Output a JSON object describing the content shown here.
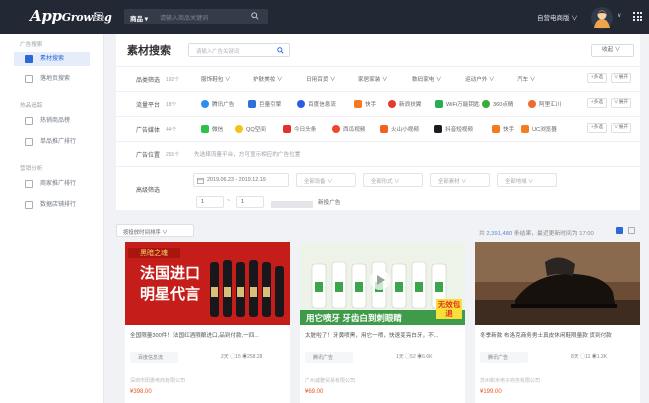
{
  "header": {
    "logo_main": "App",
    "logo_sub": "Growing",
    "search_select": "商品 ▾",
    "search_placeholder": "请输入商品关键词",
    "mode_label": "自营电商版 ∨",
    "user_arrow": "∨"
  },
  "sidebar": {
    "groups": [
      {
        "title": "广告搜索",
        "items": [
          {
            "label": "素材搜索",
            "active": true
          },
          {
            "label": "落地页搜索",
            "active": false
          }
        ]
      },
      {
        "title": "热品追踪",
        "items": [
          {
            "label": "热销商品榜",
            "active": false
          },
          {
            "label": "单品推广排行",
            "active": false
          }
        ]
      },
      {
        "title": "营销分析",
        "items": [
          {
            "label": "商家推广排行",
            "active": false
          },
          {
            "label": "数据店铺排行",
            "active": false
          }
        ]
      }
    ]
  },
  "panel": {
    "title": "素材搜索",
    "search_placeholder": "请输入广告关键词",
    "collapse_label": "收起 ∨",
    "filters": [
      {
        "label": "品类筛选",
        "count": "192个",
        "options": [
          "服饰鞋包 ∨",
          "护肤美妆 ∨",
          "日用百货 ∨",
          "家居家装 ∨",
          "数码家电 ∨",
          "运动户外 ∨",
          "汽车 ∨"
        ],
        "more": "+多选",
        "expand": "∨展开"
      },
      {
        "label": "流量平台",
        "count": "18个",
        "options": [
          "腾讯广告",
          "巨量引擎",
          "百度信息流",
          "快手",
          "新浪扶翼",
          "WiFi万能钥匙",
          "360点睛",
          "阿里汇川"
        ],
        "more": "+多选",
        "expand": "∨展开"
      },
      {
        "label": "广告媒体",
        "count": "44个",
        "options": [
          "微信",
          "QQ空间",
          "今日头条",
          "西瓜视频",
          "火山小视频",
          "抖音短视频",
          "快手",
          "UC浏览器"
        ],
        "more": "+多选",
        "expand": "∨展开"
      },
      {
        "label": "广告位置",
        "count": "291个",
        "hint": "先选择流量平台，方可显示相应的广告位置"
      }
    ],
    "advanced": {
      "label": "高级筛选",
      "date_range": "2019.06.23  -  2019.12.19",
      "selects": [
        "全部设备 ∨",
        "全部形式 ∨",
        "全部素材 ∨",
        "全部地域 ∨"
      ],
      "range_from": "1",
      "range_sep": "~",
      "range_to": "1",
      "new_ads": "新投广告"
    }
  },
  "results": {
    "sort_label": "按投放时间排序 ∨",
    "stat_prefix": "共",
    "stat_count": "2,391,480",
    "stat_suffix": "条结果，最近更新时间为 17:00"
  },
  "cards": [
    {
      "img_text_top": "黑暗之魂",
      "img_text_1": "法国进口",
      "img_text_2": "明星代言",
      "title": "全国限量300件！法国红酒限酿进口,品到付款,一四...",
      "tag": "百度信息流",
      "stats": "2天  ◯15  ◉258.28",
      "advertiser": "深圳市阳惠电商有限公司",
      "price": "¥398.00"
    },
    {
      "img_text_1": "用它喷牙 牙齿白到刺眼睛",
      "img_badge": "无效包退",
      "title": "太脏啦了！牙黄喷黑，用它一喷，快速变亮白牙，不...",
      "tag": "腾讯广告",
      "stats": "1天  ◯52  ◉6.6K",
      "advertiser": "广州诚雅贸易有限公司",
      "price": "¥69.00"
    },
    {
      "title": "冬季新款 布洛克商务男士真皮休闲鞋限量款 货到付款",
      "tag": "腾讯广告",
      "stats": "8天  ◯11  ◉1.3K",
      "advertiser": "苏州新禾电子商务有限公司",
      "price": "¥199.00"
    }
  ],
  "colors": {
    "header_bg": "#222834",
    "accent": "#2d67d8",
    "price": "#e8551e",
    "card1_bg": "#c9201c",
    "card2_bg": "#3f9a4a"
  }
}
